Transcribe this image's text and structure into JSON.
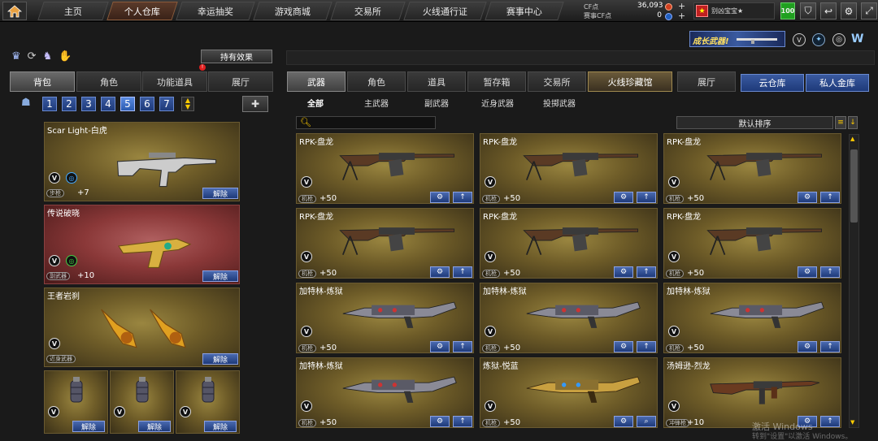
{
  "nav": {
    "tabs": [
      "主页",
      "个人仓库",
      "幸运抽奖",
      "游戏商城",
      "交易所",
      "火线通行证",
      "赛事中心"
    ],
    "active_index": 1
  },
  "currency": {
    "cf_label": "CF点",
    "cf_value": "36,093",
    "event_label": "赛事CF点",
    "event_value": "0"
  },
  "user": {
    "name": "别凶宝宝★",
    "level": "100"
  },
  "banner": {
    "text": "成长武器!"
  },
  "left": {
    "effects_button": "持有效果",
    "tabs": [
      "背包",
      "角色",
      "功能道具",
      "展厅"
    ],
    "active_tab": 0,
    "pages": [
      "1",
      "2",
      "3",
      "4",
      "5",
      "6",
      "7"
    ],
    "active_page": 4,
    "cards": [
      {
        "name": "Scar Light-白虎",
        "type": "步枪",
        "ammo": "+7",
        "action": "解除"
      },
      {
        "name": "传说破晓",
        "type": "副武器",
        "ammo": "+10",
        "action": "解除"
      },
      {
        "name": "王者岩刹",
        "type": "近身武器",
        "ammo": "",
        "action": "解除"
      }
    ],
    "grenades": [
      {
        "action": "解除"
      },
      {
        "action": "解除"
      },
      {
        "action": "解除"
      }
    ]
  },
  "right": {
    "tabs": [
      "武器",
      "角色",
      "道具",
      "暂存箱",
      "交易所",
      "火线珍藏馆",
      "展厅"
    ],
    "active_tab": 0,
    "highlight_tab": 5,
    "storage_tabs": [
      "云仓库",
      "私人金库"
    ],
    "categories": [
      "全部",
      "主武器",
      "副武器",
      "近身武器",
      "投掷武器"
    ],
    "active_category": 0,
    "sort_label": "默认排序",
    "items": [
      {
        "name": "RPK-盘龙",
        "type": "机枪",
        "ammo": "+50",
        "gun": "rpk"
      },
      {
        "name": "RPK-盘龙",
        "type": "机枪",
        "ammo": "+50",
        "gun": "rpk"
      },
      {
        "name": "RPK-盘龙",
        "type": "机枪",
        "ammo": "+50",
        "gun": "rpk"
      },
      {
        "name": "RPK-盘龙",
        "type": "机枪",
        "ammo": "+50",
        "gun": "rpk"
      },
      {
        "name": "RPK-盘龙",
        "type": "机枪",
        "ammo": "+50",
        "gun": "rpk"
      },
      {
        "name": "RPK-盘龙",
        "type": "机枪",
        "ammo": "+50",
        "gun": "rpk"
      },
      {
        "name": "加特林-炼狱",
        "type": "机枪",
        "ammo": "+50",
        "gun": "gatling"
      },
      {
        "name": "加特林-炼狱",
        "type": "机枪",
        "ammo": "+50",
        "gun": "gatling"
      },
      {
        "name": "加特林-炼狱",
        "type": "机枪",
        "ammo": "+50",
        "gun": "gatling"
      },
      {
        "name": "加特林-炼狱",
        "type": "机枪",
        "ammo": "+50",
        "gun": "gatling"
      },
      {
        "name": "炼狱-悦蓝",
        "type": "机枪",
        "ammo": "+50",
        "gun": "gatling-gold"
      },
      {
        "name": "汤姆逊-烈龙",
        "type": "冲锋枪",
        "ammo": "+10",
        "gun": "thompson"
      }
    ]
  },
  "watermark": {
    "line1": "激活 Windows",
    "line2": "转到\"设置\"以激活 Windows。"
  }
}
